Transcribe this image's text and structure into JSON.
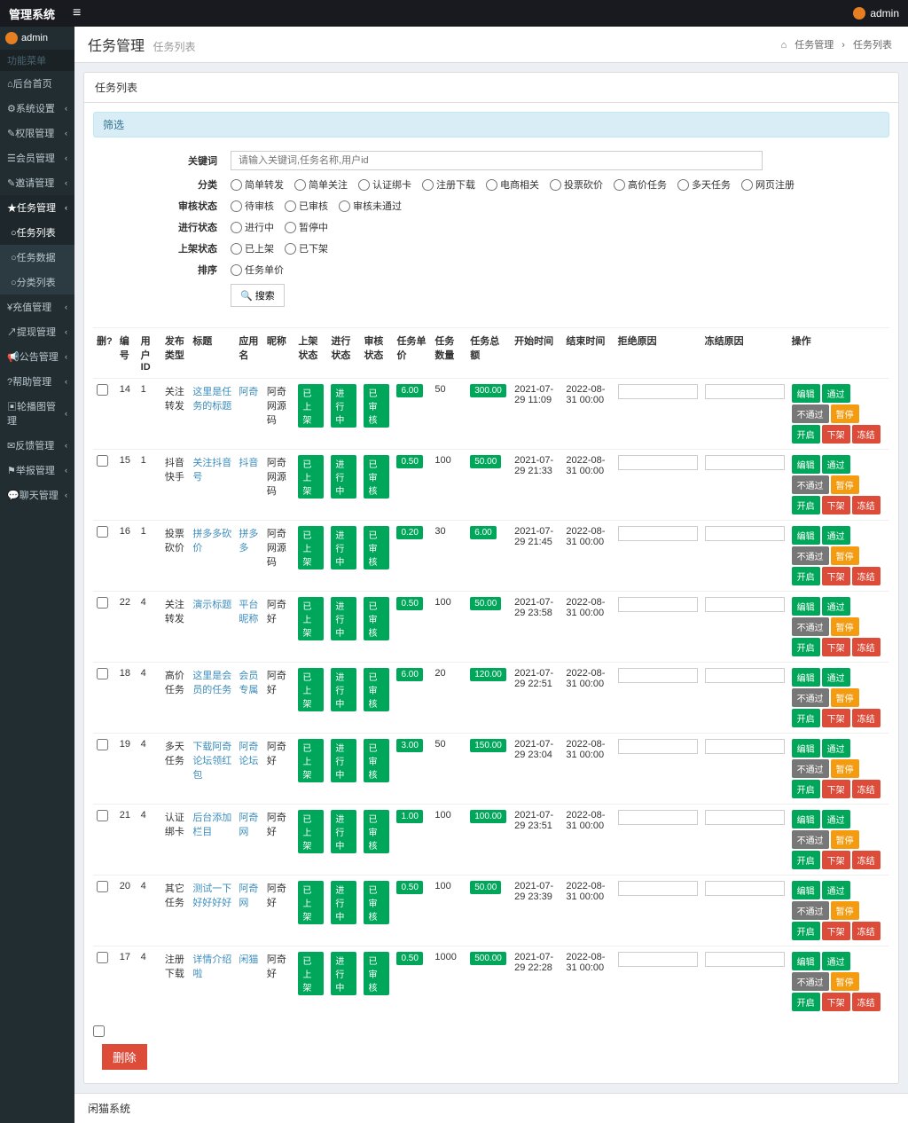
{
  "topbar": {
    "brand": "管理系统",
    "user": "admin"
  },
  "sidebar": {
    "user": "admin",
    "header": "功能菜单",
    "items": [
      {
        "label": "后台首页",
        "icon": "⌂"
      },
      {
        "label": "系统设置",
        "icon": "⚙",
        "caret": true
      },
      {
        "label": "权限管理",
        "icon": "✎",
        "caret": true
      },
      {
        "label": "会员管理",
        "icon": "☰",
        "caret": true
      },
      {
        "label": "邀请管理",
        "icon": "✎",
        "caret": true
      },
      {
        "label": "任务管理",
        "icon": "★",
        "caret": true,
        "active": true
      },
      {
        "label": "充值管理",
        "icon": "¥",
        "caret": true
      },
      {
        "label": "提现管理",
        "icon": "↗",
        "caret": true
      },
      {
        "label": "公告管理",
        "icon": "📢",
        "caret": true
      },
      {
        "label": "帮助管理",
        "icon": "?",
        "caret": true
      },
      {
        "label": "轮播图管理",
        "icon": "▣",
        "caret": true
      },
      {
        "label": "反馈管理",
        "icon": "✉",
        "caret": true
      },
      {
        "label": "举报管理",
        "icon": "⚑",
        "caret": true
      },
      {
        "label": "聊天管理",
        "icon": "💬",
        "caret": true
      }
    ],
    "submenu": [
      {
        "label": "任务列表",
        "active": true
      },
      {
        "label": "任务数据"
      },
      {
        "label": "分类列表"
      }
    ]
  },
  "page": {
    "title": "任务管理",
    "subtitle": "任务列表",
    "breadcrumb": [
      "任务管理",
      "任务列表"
    ],
    "panel_title": "任务列表",
    "filter_title": "筛选"
  },
  "filter": {
    "keyword_label": "关键词",
    "keyword_placeholder": "请输入关键词,任务名称,用户id",
    "category_label": "分类",
    "categories": [
      "简单转发",
      "简单关注",
      "认证绑卡",
      "注册下载",
      "电商相关",
      "投票砍价",
      "高价任务",
      "多天任务",
      "网页注册"
    ],
    "audit_label": "审核状态",
    "audits": [
      "待审核",
      "已审核",
      "审核未通过"
    ],
    "progress_label": "进行状态",
    "progress": [
      "进行中",
      "暂停中"
    ],
    "shelf_label": "上架状态",
    "shelf": [
      "已上架",
      "已下架"
    ],
    "sort_label": "排序",
    "sort": [
      "任务单价"
    ],
    "search_btn": "搜索"
  },
  "table": {
    "headers": [
      "删?",
      "编号",
      "用户ID",
      "发布类型",
      "标题",
      "应用名",
      "昵称",
      "上架状态",
      "进行状态",
      "审核状态",
      "任务单价",
      "任务数量",
      "任务总额",
      "开始时间",
      "结束时间",
      "拒绝原因",
      "冻结原因",
      "操作"
    ],
    "rows": [
      {
        "id": "14",
        "uid": "1",
        "type": "关注转发",
        "title": "这里是任务的标题",
        "app": "阿奇",
        "nick": "阿奇网源码",
        "shelf": "已上架",
        "prog": "进行中",
        "audit": "已审核",
        "price": "6.00",
        "qty": "50",
        "total": "300.00",
        "start": "2021-07-29 11:09",
        "end": "2022-08-31 00:00"
      },
      {
        "id": "15",
        "uid": "1",
        "type": "抖音快手",
        "title": "关注抖音号",
        "app": "抖音",
        "nick": "阿奇网源码",
        "shelf": "已上架",
        "prog": "进行中",
        "audit": "已审核",
        "price": "0.50",
        "qty": "100",
        "total": "50.00",
        "start": "2021-07-29 21:33",
        "end": "2022-08-31 00:00"
      },
      {
        "id": "16",
        "uid": "1",
        "type": "投票砍价",
        "title": "拼多多砍价",
        "app": "拼多多",
        "nick": "阿奇网源码",
        "shelf": "已上架",
        "prog": "进行中",
        "audit": "已审核",
        "price": "0.20",
        "qty": "30",
        "total": "6.00",
        "start": "2021-07-29 21:45",
        "end": "2022-08-31 00:00"
      },
      {
        "id": "22",
        "uid": "4",
        "type": "关注转发",
        "title": "演示标题",
        "app": "平台昵称",
        "nick": "阿奇好",
        "shelf": "已上架",
        "prog": "进行中",
        "audit": "已审核",
        "price": "0.50",
        "qty": "100",
        "total": "50.00",
        "start": "2021-07-29 23:58",
        "end": "2022-08-31 00:00"
      },
      {
        "id": "18",
        "uid": "4",
        "type": "高价任务",
        "title": "这里是会员的任务",
        "app": "会员专属",
        "nick": "阿奇好",
        "shelf": "已上架",
        "prog": "进行中",
        "audit": "已审核",
        "price": "6.00",
        "qty": "20",
        "total": "120.00",
        "start": "2021-07-29 22:51",
        "end": "2022-08-31 00:00"
      },
      {
        "id": "19",
        "uid": "4",
        "type": "多天任务",
        "title": "下载阿奇论坛领红包",
        "app": "阿奇论坛",
        "nick": "阿奇好",
        "shelf": "已上架",
        "prog": "进行中",
        "audit": "已审核",
        "price": "3.00",
        "qty": "50",
        "total": "150.00",
        "start": "2021-07-29 23:04",
        "end": "2022-08-31 00:00"
      },
      {
        "id": "21",
        "uid": "4",
        "type": "认证绑卡",
        "title": "后台添加栏目",
        "app": "阿奇网",
        "nick": "阿奇好",
        "shelf": "已上架",
        "prog": "进行中",
        "audit": "已审核",
        "price": "1.00",
        "qty": "100",
        "total": "100.00",
        "start": "2021-07-29 23:51",
        "end": "2022-08-31 00:00"
      },
      {
        "id": "20",
        "uid": "4",
        "type": "其它任务",
        "title": "测试一下好好好好",
        "app": "阿奇网",
        "nick": "阿奇好",
        "shelf": "已上架",
        "prog": "进行中",
        "audit": "已审核",
        "price": "0.50",
        "qty": "100",
        "total": "50.00",
        "start": "2021-07-29 23:39",
        "end": "2022-08-31 00:00"
      },
      {
        "id": "17",
        "uid": "4",
        "type": "注册下载",
        "title": "详情介绍啦",
        "app": "闲猫",
        "nick": "阿奇好",
        "shelf": "已上架",
        "prog": "进行中",
        "audit": "已审核",
        "price": "0.50",
        "qty": "1000",
        "total": "500.00",
        "start": "2021-07-29 22:28",
        "end": "2022-08-31 00:00"
      }
    ],
    "actions": {
      "edit": "编辑",
      "pass": "通过",
      "reject": "不通过",
      "pause": "暂停",
      "start": "开启",
      "delist": "下架",
      "freeze": "冻结"
    },
    "delete_btn": "删除"
  },
  "footer": "闲猫系统"
}
